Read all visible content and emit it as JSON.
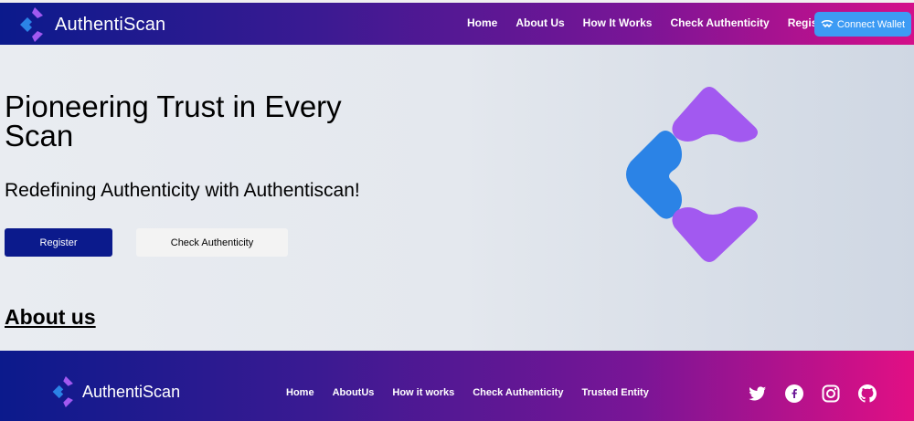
{
  "header": {
    "brand": "AuthentiScan",
    "nav": [
      {
        "label": "Home"
      },
      {
        "label": "About Us"
      },
      {
        "label": "How It Works"
      },
      {
        "label": "Check Authenticity"
      },
      {
        "label": "Register"
      }
    ],
    "wallet_label": "Connect Wallet"
  },
  "hero": {
    "title": "Pioneering Trust in Every Scan",
    "subtitle": "Redefining Authenticity with Authentiscan!",
    "register_label": "Register",
    "check_label": "Check Authenticity"
  },
  "about": {
    "heading": "About us"
  },
  "footer": {
    "brand": "AuthentiScan",
    "nav": [
      {
        "label": "Home"
      },
      {
        "label": "AboutUs"
      },
      {
        "label": "How it works"
      },
      {
        "label": "Check Authenticity"
      },
      {
        "label": "Trusted Entity"
      }
    ],
    "social": [
      "twitter-icon",
      "facebook-icon",
      "instagram-icon",
      "github-icon"
    ]
  },
  "colors": {
    "brand_navy": "#0b1a8c",
    "brand_pink": "#d40f8a",
    "logo_purple": "#a259f0",
    "logo_blue": "#2b83e6",
    "wallet_blue": "#3d9bf4"
  }
}
